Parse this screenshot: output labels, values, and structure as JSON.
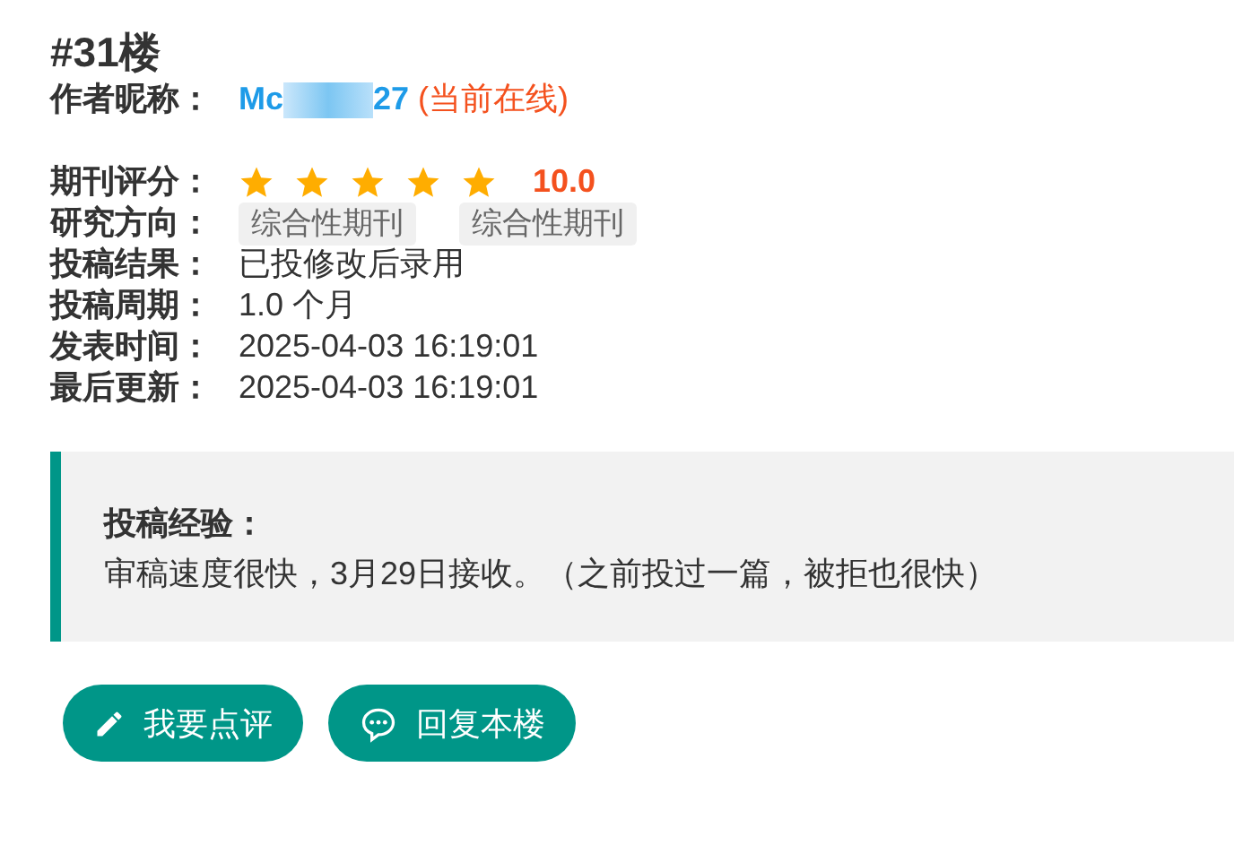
{
  "floor": "#31楼",
  "author": {
    "label": "作者昵称：",
    "name_start": "Mc",
    "name_end": "27",
    "status": "(当前在线)"
  },
  "rating": {
    "label": "期刊评分：",
    "stars": 5,
    "score": "10.0"
  },
  "fields": [
    {
      "kind": "tags",
      "label": "研究方向：",
      "tags": [
        "综合性期刊",
        "综合性期刊"
      ]
    },
    {
      "kind": "text",
      "label": "投稿结果：",
      "value": "已投修改后录用"
    },
    {
      "kind": "text",
      "label": "投稿周期：",
      "value": "1.0 个月"
    },
    {
      "kind": "text",
      "label": "发表时间：",
      "value": "2025-04-03 16:19:01"
    },
    {
      "kind": "text",
      "label": "最后更新：",
      "value": "2025-04-03 16:19:01"
    }
  ],
  "experience": {
    "title": "投稿经验：",
    "text": "审稿速度很快，3月29日接收。（之前投过一篇，被拒也很快）"
  },
  "buttons": [
    {
      "kind": "pencil",
      "label": "我要点评"
    },
    {
      "kind": "chat",
      "label": "回复本楼"
    }
  ]
}
